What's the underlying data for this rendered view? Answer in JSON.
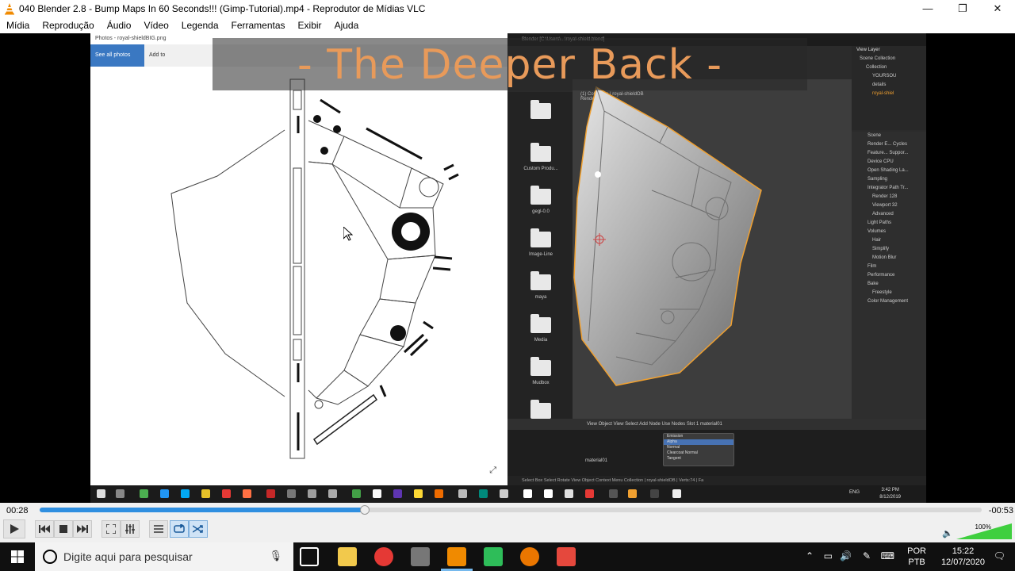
{
  "window": {
    "title": "040 Blender 2.8 - Bump Maps In 60 Seconds!!! (Gimp-Tutorial).mp4 - Reprodutor de Mídias VLC",
    "minimize": "—",
    "maximize": "❐",
    "close": "✕"
  },
  "menu": [
    "Mídia",
    "Reprodução",
    "Áudio",
    "Vídeo",
    "Legenda",
    "Ferramentas",
    "Exibir",
    "Ajuda"
  ],
  "video": {
    "overlay_text": "- The Deeper Back -",
    "photos": {
      "window_title": "Photos - royal-shieldBIG.png",
      "see_all": "See all photos",
      "add_to": "Add to"
    },
    "blender": {
      "topbar": "Blender [C:\\Users\\...\\royal-shield.blend]",
      "view_layer": "View Layer",
      "status": "(1) Collection | royal-shieldOB",
      "rendering": "Rendering Done",
      "folders": [
        "",
        "Custom Produ...",
        "gegl-0.0",
        "Image-Line",
        "maya",
        "Media",
        "Mudbox",
        ""
      ],
      "outliner": [
        "Scene Collection",
        "Collection",
        "YOURSOU",
        "details",
        "royal-shiel"
      ],
      "props": [
        "Scene",
        "Render E... Cycles",
        "Feature... Suppor...",
        "Device    CPU",
        "Open Shading La...",
        "Sampling",
        "Integrator  Path Tr...",
        "Render  128",
        "Viewport  32",
        "Advanced",
        "Light Paths",
        "Volumes",
        "Hair",
        "Simplify",
        "Motion Blur",
        "Film",
        "Performance",
        "Bake",
        "Freestyle",
        "Color Management"
      ],
      "node_header": "View   Object   View   Select   Add   Node   Use Nodes   Slot 1   material01",
      "node_menu": [
        "Emission",
        "Alpha",
        "Normal",
        "Clearcoat Normal",
        "Tangent"
      ],
      "material_label": "material01",
      "status_bar": "Select   Box Select   Rotate View   Object Context Menu   Collection | royal-shieldOB | Verts:74 | Fa"
    },
    "inner_clock": {
      "time": "3:42 PM",
      "date": "8/12/2019"
    },
    "inner_lang": "ENG"
  },
  "player": {
    "elapsed": "00:28",
    "remaining": "-00:53",
    "progress_fraction": 0.345,
    "volume": "100%",
    "volume_fraction": 1.0
  },
  "taskbar": {
    "search_placeholder": "Digite aqui para pesquisar",
    "lang_top": "POR",
    "lang_bottom": "PTB",
    "time": "15:22",
    "date": "12/07/2020"
  },
  "colors": {
    "seek": "#2f8fe0",
    "overlay_text": "#e89a5a",
    "blender_selection": "#f0a030",
    "photos_accent": "#3a78c2"
  }
}
